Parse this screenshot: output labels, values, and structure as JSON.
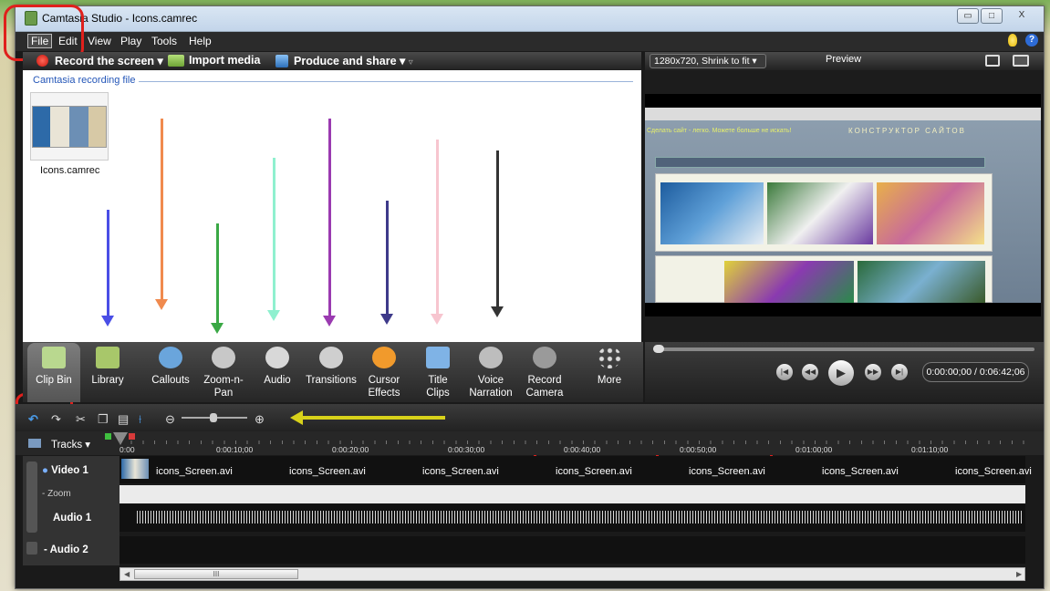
{
  "window": {
    "title": "Camtasia Studio - Icons.camrec",
    "minimize_label": "▭",
    "maximize_label": "□",
    "close_label": "X"
  },
  "menu": [
    "File",
    "Edit",
    "View",
    "Play",
    "Tools",
    "Help"
  ],
  "toolbar": {
    "record": "Record the screen",
    "import": "Import media",
    "produce": "Produce and share"
  },
  "clip_bin": {
    "section_label": "Camtasia recording file",
    "items": [
      {
        "name": "Icons.camrec"
      }
    ]
  },
  "task_tabs": [
    {
      "label": "Clip Bin",
      "icon": "document-icon",
      "color": "#b9d88f"
    },
    {
      "label": "Library",
      "icon": "folder-icon",
      "color": "#a8c76a"
    },
    {
      "label": "Callouts",
      "icon": "speech-bubble-icon",
      "color": "#6aa5dc"
    },
    {
      "label": "Zoom-n-\nPan",
      "icon": "magnifier-icon",
      "color": "#c8c8c8"
    },
    {
      "label": "Audio",
      "icon": "speaker-icon",
      "color": "#d8d8d8"
    },
    {
      "label": "Transitions",
      "icon": "transition-icon",
      "color": "#cfcfcf"
    },
    {
      "label": "Cursor\nEffects",
      "icon": "cursor-icon",
      "color": "#f19a2c"
    },
    {
      "label": "Title\nClips",
      "icon": "title-clip-icon",
      "color": "#7fb3e6"
    },
    {
      "label": "Voice\nNarration",
      "icon": "microphone-icon",
      "color": "#bdbdbd"
    },
    {
      "label": "Record\nCamera",
      "icon": "camera-icon",
      "color": "#9a9a9a"
    },
    {
      "label": "More",
      "icon": "dots-icon",
      "color": "#cccccc"
    }
  ],
  "preview": {
    "size_select": "1280x720, Shrink to fit",
    "title": "Preview",
    "page_text": "Сделать сайт - легко. Можете больше не искать!",
    "page_heading": "КОНСТРУКТОР САЙТОВ",
    "time": "0:00:00;00 / 0:06:42;06"
  },
  "timeline": {
    "tracks_label": "Tracks",
    "ticks": [
      "0:00",
      "0:00:10;00",
      "0:00:20;00",
      "0:00:30;00",
      "0:00:40;00",
      "0:00:50;00",
      "0:01:00;00",
      "0:01:10;00"
    ],
    "tracks": [
      "Video 1",
      "Zoom",
      "Audio 1",
      "Audio 2"
    ],
    "clips": [
      "icons_Screen.avi",
      "icons_Screen.avi",
      "icons_Screen.avi",
      "icons_Screen.avi",
      "icons_Screen.avi",
      "icons_Screen.avi",
      "icons_Screen.avi"
    ],
    "scroll_thumb": "III"
  },
  "annotations": {
    "arrow_colors": [
      "#4a4ee6",
      "#f08a4e",
      "#3aa845",
      "#8ff0cf",
      "#9a3ab0",
      "#3e3a8a",
      "#f7c5cf",
      "#333333"
    ],
    "yellow_arrow": "#d8d21a",
    "red": "#e0201c"
  }
}
